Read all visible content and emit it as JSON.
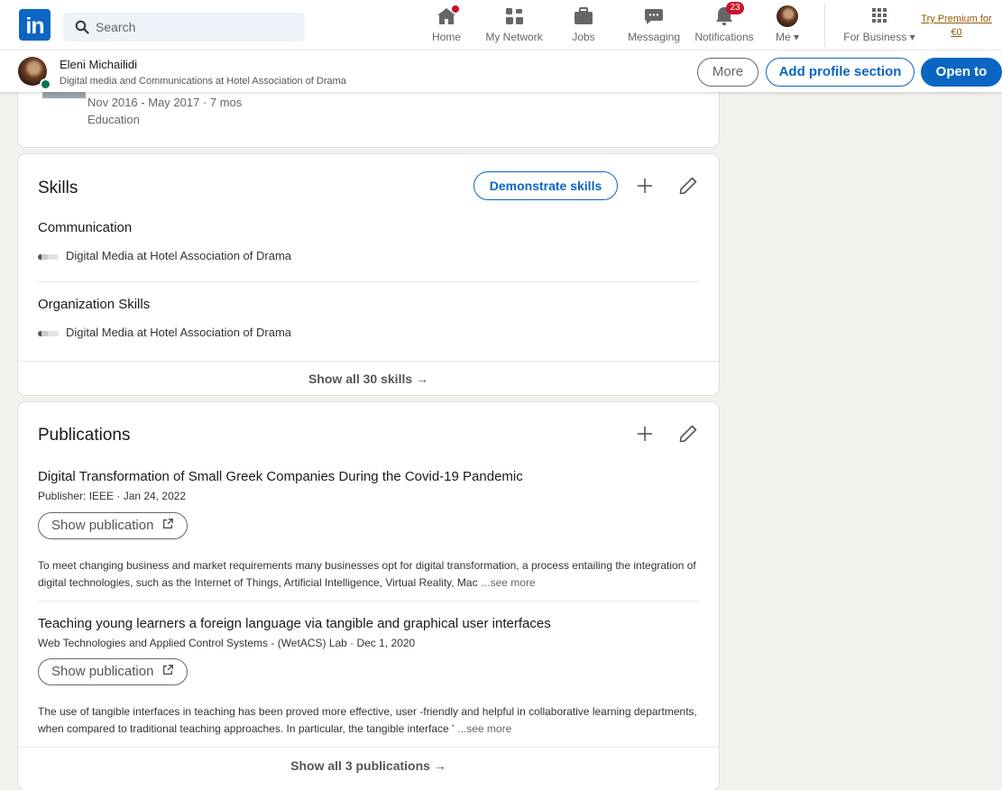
{
  "nav": {
    "logo": "in",
    "search_placeholder": "Search",
    "items": [
      {
        "label": "Home",
        "icon": "home-icon"
      },
      {
        "label": "My Network",
        "icon": "network-icon"
      },
      {
        "label": "Jobs",
        "icon": "briefcase-icon"
      },
      {
        "label": "Messaging",
        "icon": "messaging-icon"
      },
      {
        "label": "Notifications",
        "icon": "bell-icon",
        "badge": "23"
      },
      {
        "label": "Me",
        "icon": "avatar-icon"
      },
      {
        "label": "For Business",
        "icon": "grid-icon"
      }
    ],
    "premium_line1": "Try Premium for",
    "premium_line2": "€0"
  },
  "profile_bar": {
    "name": "Eleni Michailidi",
    "headline": "Digital media and Communications at Hotel Association of Drama",
    "more": "More",
    "add_section": "Add profile section",
    "open_to": "Open to"
  },
  "education_partial": {
    "dates": "Nov 2016 - May 2017 · 7 mos",
    "type": "Education"
  },
  "skills": {
    "title": "Skills",
    "demonstrate": "Demonstrate skills",
    "items": [
      {
        "name": "Communication",
        "context": "Digital Media at Hotel Association of Drama"
      },
      {
        "name": "Organization Skills",
        "context": "Digital Media at Hotel Association of Drama"
      }
    ],
    "show_all": "Show all 30 skills →"
  },
  "publications": {
    "title": "Publications",
    "show_label": "Show publication",
    "see_more": "...see more",
    "items": [
      {
        "title": "Digital Transformation of Small Greek Companies During the Covid-19 Pandemic",
        "meta": "Publisher: IEEE · Jan 24, 2022",
        "description": "To meet changing business and market requirements many businesses opt for digital transformation, a process entailing the integration of digital technologies, such as the Internet of Things, Artificial Intelligence, Virtual Reality, Mac"
      },
      {
        "title": "Teaching young learners a foreign language via tangible and graphical user interfaces",
        "meta": "Web Technologies and Applied Control Systems - (WetACS) Lab · Dec 1, 2020",
        "description": "The use of tangible interfaces in teaching has been proved more effective, user -friendly and helpful in collaborative learning departments, when compared to traditional teaching approaches. In particular, the tangible interface '"
      }
    ],
    "show_all": "Show all 3 publications →"
  },
  "colors": {
    "brand": "#0a66c2",
    "badge": "#cb112d",
    "premium": "#915907",
    "page_bg": "#f4f2ee"
  }
}
